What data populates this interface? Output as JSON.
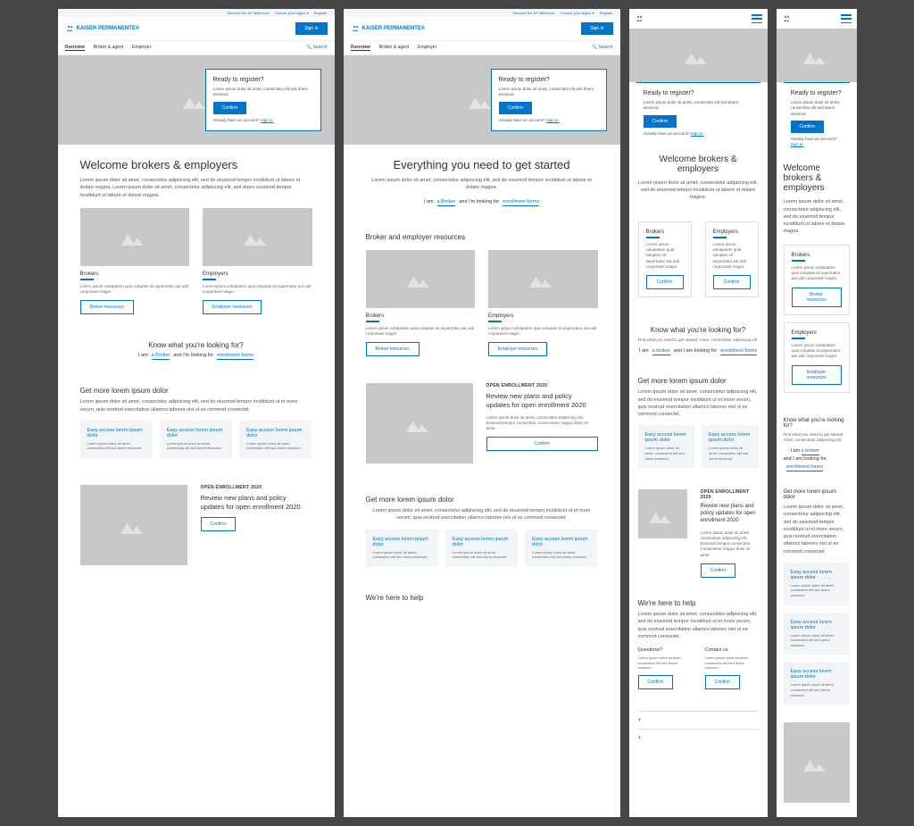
{
  "top": {
    "diff": "Discover the KP difference",
    "region": "Choose your region ▾",
    "reg": "Register"
  },
  "brand": "KAISER PERMANENTE®",
  "signin": "Sign in",
  "nav": {
    "t1": "Overview",
    "t2": "Broker & agent",
    "t3": "Employer",
    "search": "🔍 Search"
  },
  "reg": {
    "title": "Ready to register?",
    "body": "Lorem ipsum dolor sit amet, consectetu elit sed doers eiusmod.",
    "btn": "Confirm",
    "already": "Already have an account? ",
    "link": "Sign in."
  },
  "w1": {
    "h": "Welcome brokers & employers",
    "p": "Lorem ipsum dolor sit amet, consectetur adipiscing elit, sed do eiusmod tempor incididunt ut labore et dolare magna. Lorem ipsum dolor sit amet, consectetur adipiscing elit, sed doers eiusmod tempor incididunt ut labore et dolore magna."
  },
  "w2": {
    "h": "Everything you need to get started",
    "p": "Lorem ipsum dolor sit amet, consectetur adipiscing elit, sed do eiusmod tempor incididunt ut labore et dolare magna."
  },
  "br": {
    "t": "Brokers",
    "p": "Lorem ipsum volutpatem quia voluptas sit aspernatur aut odit corporavel magni.",
    "btn": "Broker resources"
  },
  "em": {
    "t": "Employers",
    "p": "Lorem ipsum volutpatem quia voluptas sit aspernatur aut odit corporavel magni.",
    "btn": "Employer resources"
  },
  "res": "Broker and employer resources",
  "know": {
    "h": "Know what you're looking for?",
    "p": "Find what you need to get started. Amet, consectetur adipiscing elit.",
    "a": "I am ",
    "b": "a Broker",
    "c": "and I'm looking for",
    "c2": "and I am looking for",
    "d": "enrollment forms",
    "b2": "a broker"
  },
  "more": {
    "h": "Get more lorem ipsum dolor",
    "p": "Lorem ipsum dolor sit amet, consectetur adipiscing elit, sed do eiusmod tempor incididunt ut et more verum, quis nostrud exercitation ullamco labores nisi ut ex commod consectet."
  },
  "tile": {
    "h": "Easy access lorem ipsum dolor",
    "p": "Lorem ipsum dolor sit amet, consectetu elit sed doers eiusmod."
  },
  "en": {
    "k": "OPEN ENROLLMENT 2020",
    "h": "Review new plans and policy updates for open enrollment 2020",
    "p": "Lorem ipsum dolor sit amet, consectetur adipiscing elit. Eiusmod tempor consectetu. Consectetur magus dolor sit amet.",
    "btn": "Confirm"
  },
  "help": {
    "h": "We're here to help",
    "p": "Lorem ipsum dolor sit amet, consectetur adipiscing elit, sed do eiusmod tempor incididunt ut et more verum, quis nostrud exercitation ullamco labores nisi ut ea commod consectet.",
    "q": "Questions?",
    "c": "Contact us",
    "qp": "Lorem ipsum dolor sit amet, consectetu elit sed doers eiusmod.",
    "btn": "Confirm"
  },
  "plus": "+"
}
